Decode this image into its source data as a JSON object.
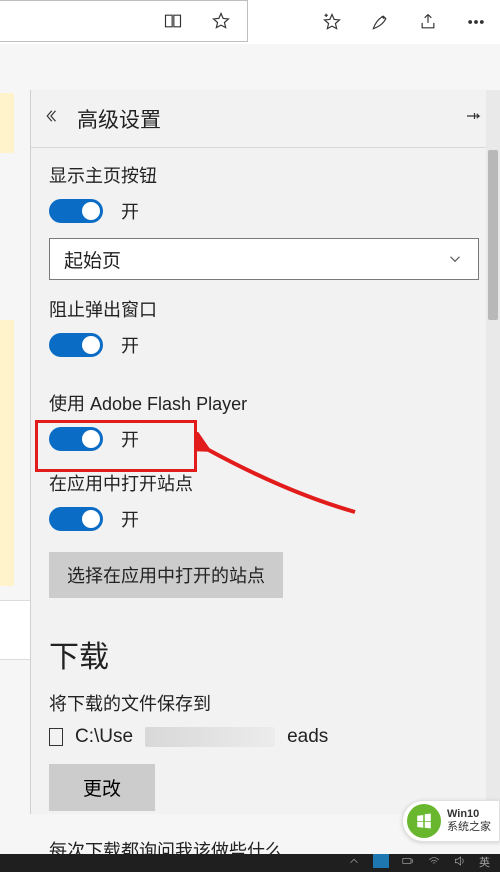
{
  "toolbar": {
    "icons": [
      "reading-view-icon",
      "favorite-star-icon",
      "add-favorite-icon",
      "notes-pen-icon",
      "share-icon",
      "more-icon"
    ]
  },
  "panel": {
    "title": "高级设置",
    "settings": {
      "show_home": {
        "label": "显示主页按钮",
        "state": "开"
      },
      "homepage_select": {
        "value": "起始页"
      },
      "block_popups": {
        "label": "阻止弹出窗口",
        "state": "开"
      },
      "flash": {
        "label": "使用 Adobe Flash Player",
        "state": "开"
      },
      "open_in_app": {
        "label": "在应用中打开站点",
        "state": "开",
        "button": "选择在应用中打开的站点"
      }
    },
    "downloads": {
      "heading": "下载",
      "save_to_label": "将下载的文件保存到",
      "path_prefix": "C:\\Use",
      "path_suffix": "eads",
      "change_button": "更改",
      "ask_each_time": "每次下载都询问我该做些什么"
    }
  },
  "watermark": {
    "line1": "Win10",
    "line2": "系统之家"
  }
}
